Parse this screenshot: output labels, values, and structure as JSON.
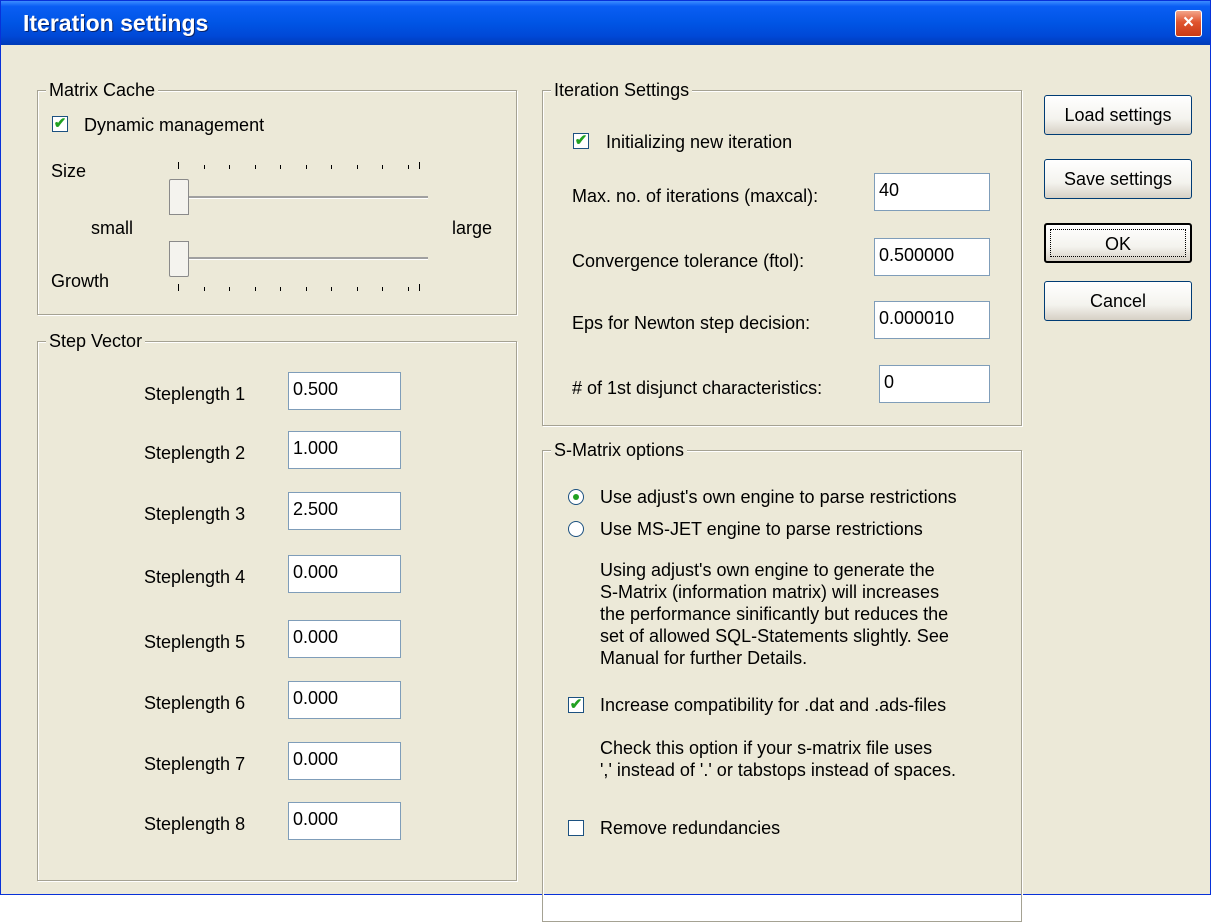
{
  "window": {
    "title": "Iteration settings",
    "close_glyph": "×"
  },
  "matrix_cache": {
    "legend": "Matrix Cache",
    "dynamic_label": "Dynamic management",
    "dynamic_checked": true,
    "size_label": "Size",
    "small_label": "small",
    "large_label": "large",
    "growth_label": "Growth"
  },
  "step_vector": {
    "legend": "Step Vector",
    "rows": [
      {
        "label": "Steplength 1",
        "value": "0.500"
      },
      {
        "label": "Steplength 2",
        "value": "1.000"
      },
      {
        "label": "Steplength 3",
        "value": "2.500"
      },
      {
        "label": "Steplength 4",
        "value": "0.000"
      },
      {
        "label": "Steplength 5",
        "value": "0.000"
      },
      {
        "label": "Steplength 6",
        "value": "0.000"
      },
      {
        "label": "Steplength 7",
        "value": "0.000"
      },
      {
        "label": "Steplength 8",
        "value": "0.000"
      }
    ]
  },
  "iteration_settings": {
    "legend": "Iteration Settings",
    "init_label": "Initializing new iteration",
    "init_checked": true,
    "maxcal_label": "Max. no. of iterations (maxcal):",
    "maxcal_value": "40",
    "ftol_label": "Convergence tolerance (ftol):",
    "ftol_value": "0.500000",
    "eps_label": "Eps for Newton step decision:",
    "eps_value": "0.000010",
    "disjunct_label": "# of 1st disjunct characteristics:",
    "disjunct_value": "0"
  },
  "s_matrix": {
    "legend": "S-Matrix options",
    "own_engine_label": "Use adjust's own engine to parse restrictions",
    "own_engine_selected": true,
    "msjet_label": "Use MS-JET engine to parse restrictions",
    "engine_desc": [
      "Using adjust's own engine to generate the",
      "S-Matrix (information matrix) will increases",
      "the performance sinificantly but reduces the",
      "set of allowed SQL-Statements slightly. See",
      "Manual for further Details."
    ],
    "compat_label": "Increase compatibility for .dat and .ads-files",
    "compat_checked": true,
    "compat_desc": [
      "Check this option if your s-matrix file uses",
      "',' instead of '.' or tabstops instead of spaces."
    ],
    "redundancies_label": "Remove redundancies",
    "redundancies_checked": false
  },
  "buttons": {
    "load": "Load settings",
    "save": "Save settings",
    "ok": "OK",
    "cancel": "Cancel"
  },
  "check_glyph": "✔"
}
